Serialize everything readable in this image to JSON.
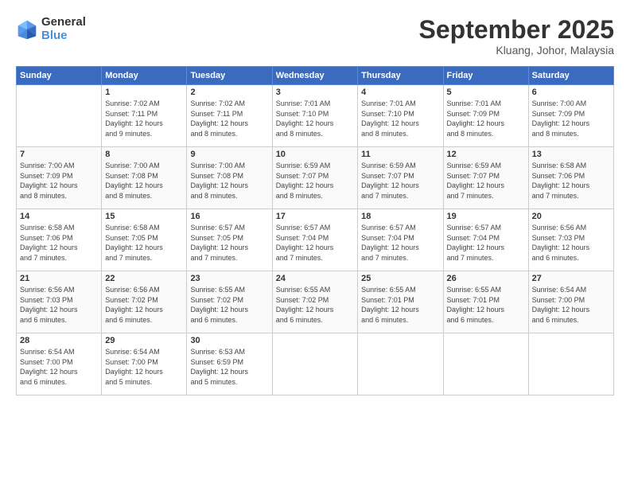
{
  "logo": {
    "line1": "General",
    "line2": "Blue"
  },
  "title": "September 2025",
  "location": "Kluang, Johor, Malaysia",
  "days_of_week": [
    "Sunday",
    "Monday",
    "Tuesday",
    "Wednesday",
    "Thursday",
    "Friday",
    "Saturday"
  ],
  "weeks": [
    [
      {
        "day": "",
        "info": ""
      },
      {
        "day": "1",
        "info": "Sunrise: 7:02 AM\nSunset: 7:11 PM\nDaylight: 12 hours\nand 9 minutes."
      },
      {
        "day": "2",
        "info": "Sunrise: 7:02 AM\nSunset: 7:11 PM\nDaylight: 12 hours\nand 8 minutes."
      },
      {
        "day": "3",
        "info": "Sunrise: 7:01 AM\nSunset: 7:10 PM\nDaylight: 12 hours\nand 8 minutes."
      },
      {
        "day": "4",
        "info": "Sunrise: 7:01 AM\nSunset: 7:10 PM\nDaylight: 12 hours\nand 8 minutes."
      },
      {
        "day": "5",
        "info": "Sunrise: 7:01 AM\nSunset: 7:09 PM\nDaylight: 12 hours\nand 8 minutes."
      },
      {
        "day": "6",
        "info": "Sunrise: 7:00 AM\nSunset: 7:09 PM\nDaylight: 12 hours\nand 8 minutes."
      }
    ],
    [
      {
        "day": "7",
        "info": "Sunrise: 7:00 AM\nSunset: 7:09 PM\nDaylight: 12 hours\nand 8 minutes."
      },
      {
        "day": "8",
        "info": "Sunrise: 7:00 AM\nSunset: 7:08 PM\nDaylight: 12 hours\nand 8 minutes."
      },
      {
        "day": "9",
        "info": "Sunrise: 7:00 AM\nSunset: 7:08 PM\nDaylight: 12 hours\nand 8 minutes."
      },
      {
        "day": "10",
        "info": "Sunrise: 6:59 AM\nSunset: 7:07 PM\nDaylight: 12 hours\nand 8 minutes."
      },
      {
        "day": "11",
        "info": "Sunrise: 6:59 AM\nSunset: 7:07 PM\nDaylight: 12 hours\nand 7 minutes."
      },
      {
        "day": "12",
        "info": "Sunrise: 6:59 AM\nSunset: 7:07 PM\nDaylight: 12 hours\nand 7 minutes."
      },
      {
        "day": "13",
        "info": "Sunrise: 6:58 AM\nSunset: 7:06 PM\nDaylight: 12 hours\nand 7 minutes."
      }
    ],
    [
      {
        "day": "14",
        "info": "Sunrise: 6:58 AM\nSunset: 7:06 PM\nDaylight: 12 hours\nand 7 minutes."
      },
      {
        "day": "15",
        "info": "Sunrise: 6:58 AM\nSunset: 7:05 PM\nDaylight: 12 hours\nand 7 minutes."
      },
      {
        "day": "16",
        "info": "Sunrise: 6:57 AM\nSunset: 7:05 PM\nDaylight: 12 hours\nand 7 minutes."
      },
      {
        "day": "17",
        "info": "Sunrise: 6:57 AM\nSunset: 7:04 PM\nDaylight: 12 hours\nand 7 minutes."
      },
      {
        "day": "18",
        "info": "Sunrise: 6:57 AM\nSunset: 7:04 PM\nDaylight: 12 hours\nand 7 minutes."
      },
      {
        "day": "19",
        "info": "Sunrise: 6:57 AM\nSunset: 7:04 PM\nDaylight: 12 hours\nand 7 minutes."
      },
      {
        "day": "20",
        "info": "Sunrise: 6:56 AM\nSunset: 7:03 PM\nDaylight: 12 hours\nand 6 minutes."
      }
    ],
    [
      {
        "day": "21",
        "info": "Sunrise: 6:56 AM\nSunset: 7:03 PM\nDaylight: 12 hours\nand 6 minutes."
      },
      {
        "day": "22",
        "info": "Sunrise: 6:56 AM\nSunset: 7:02 PM\nDaylight: 12 hours\nand 6 minutes."
      },
      {
        "day": "23",
        "info": "Sunrise: 6:55 AM\nSunset: 7:02 PM\nDaylight: 12 hours\nand 6 minutes."
      },
      {
        "day": "24",
        "info": "Sunrise: 6:55 AM\nSunset: 7:02 PM\nDaylight: 12 hours\nand 6 minutes."
      },
      {
        "day": "25",
        "info": "Sunrise: 6:55 AM\nSunset: 7:01 PM\nDaylight: 12 hours\nand 6 minutes."
      },
      {
        "day": "26",
        "info": "Sunrise: 6:55 AM\nSunset: 7:01 PM\nDaylight: 12 hours\nand 6 minutes."
      },
      {
        "day": "27",
        "info": "Sunrise: 6:54 AM\nSunset: 7:00 PM\nDaylight: 12 hours\nand 6 minutes."
      }
    ],
    [
      {
        "day": "28",
        "info": "Sunrise: 6:54 AM\nSunset: 7:00 PM\nDaylight: 12 hours\nand 6 minutes."
      },
      {
        "day": "29",
        "info": "Sunrise: 6:54 AM\nSunset: 7:00 PM\nDaylight: 12 hours\nand 5 minutes."
      },
      {
        "day": "30",
        "info": "Sunrise: 6:53 AM\nSunset: 6:59 PM\nDaylight: 12 hours\nand 5 minutes."
      },
      {
        "day": "",
        "info": ""
      },
      {
        "day": "",
        "info": ""
      },
      {
        "day": "",
        "info": ""
      },
      {
        "day": "",
        "info": ""
      }
    ]
  ]
}
